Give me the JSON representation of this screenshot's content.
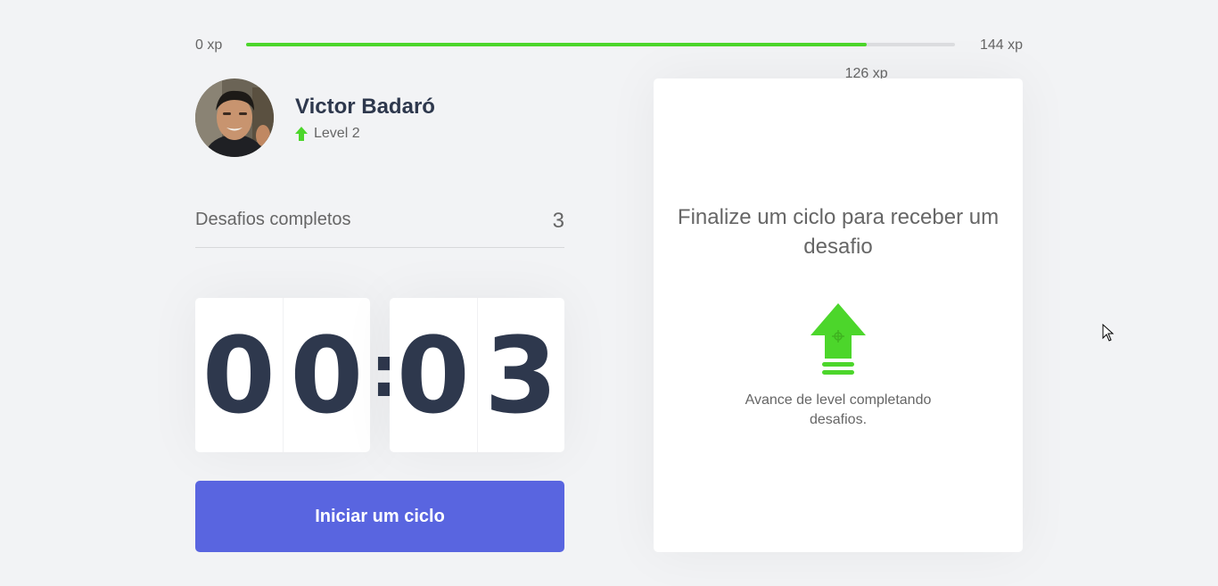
{
  "xp": {
    "min_label": "0 xp",
    "max_label": "144 xp",
    "current_label": "126 xp",
    "current": 126,
    "max": 144,
    "fill_color": "#4cd62b"
  },
  "profile": {
    "name": "Victor Badaró",
    "level_label": "Level 2",
    "level_icon": "level-up-arrow-icon"
  },
  "challenges": {
    "label": "Desafios completos",
    "count": "3"
  },
  "countdown": {
    "minute_left": "0",
    "minute_right": "0",
    "separator": ":",
    "second_left": "0",
    "second_right": "3"
  },
  "start_button": {
    "label": "Iniciar um ciclo",
    "color": "#5965e0"
  },
  "challenge_box": {
    "title": "Finalize um ciclo para receber um desafio",
    "icon": "level-up-icon",
    "subtitle": "Avance de level completando desafios."
  },
  "colors": {
    "background": "#f2f3f5",
    "text": "#666666",
    "title": "#2e384d",
    "green": "#4cd62b"
  }
}
